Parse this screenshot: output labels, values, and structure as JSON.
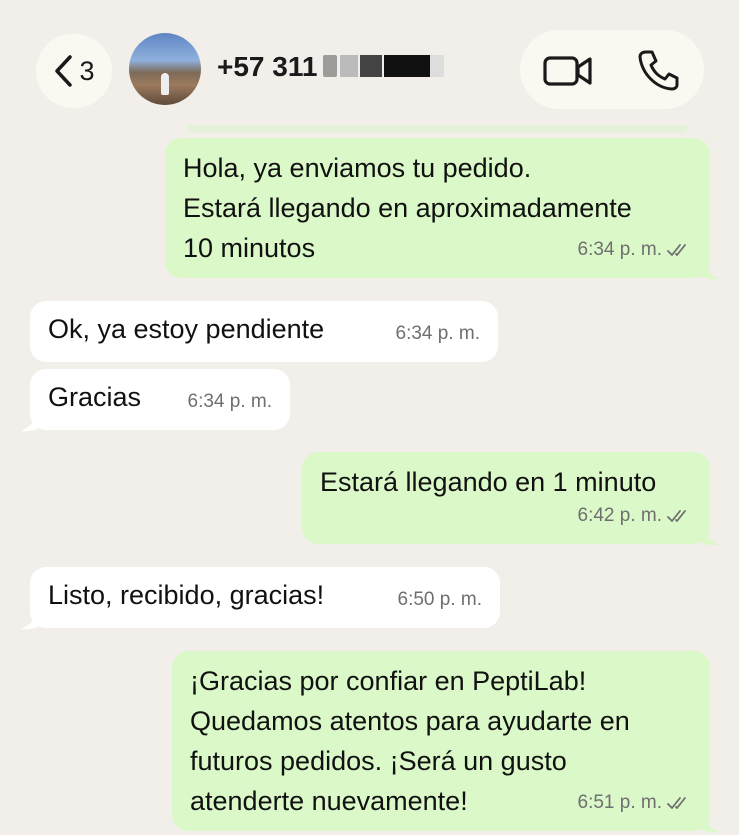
{
  "header": {
    "back_count": "3",
    "contact_name": "+57 311",
    "icons": [
      "chevron-left-icon",
      "video-call-icon",
      "phone-icon"
    ]
  },
  "messages": [
    {
      "direction": "out",
      "lines": [
        "Hola, ya enviamos tu pedido.",
        "Estará llegando en aproximadamente",
        "10 minutos"
      ],
      "time": "6:34 p. m.",
      "status": "read"
    },
    {
      "direction": "in",
      "lines": [
        "Ok, ya estoy pendiente"
      ],
      "time": "6:34 p. m."
    },
    {
      "direction": "in",
      "lines": [
        "Gracias"
      ],
      "time": "6:34 p. m."
    },
    {
      "direction": "out",
      "lines": [
        "Estará llegando en 1 minuto"
      ],
      "time": "6:42 p. m.",
      "status": "read"
    },
    {
      "direction": "in",
      "lines": [
        "Listo, recibido, gracias!"
      ],
      "time": "6:50 p. m."
    },
    {
      "direction": "out",
      "lines": [
        "¡Gracias por confiar en PeptiLab!",
        "Quedamos atentos para ayudarte en",
        "futuros pedidos. ¡Será un gusto",
        "atenderte nuevamente!"
      ],
      "time": "6:51 p. m.",
      "status": "read"
    }
  ],
  "colors": {
    "background": "#f2efea",
    "outgoing_bubble": "#dbf8c8",
    "incoming_bubble": "#ffffff",
    "header_pill": "#fbf8f2",
    "timestamp": "#6f6f6f"
  }
}
